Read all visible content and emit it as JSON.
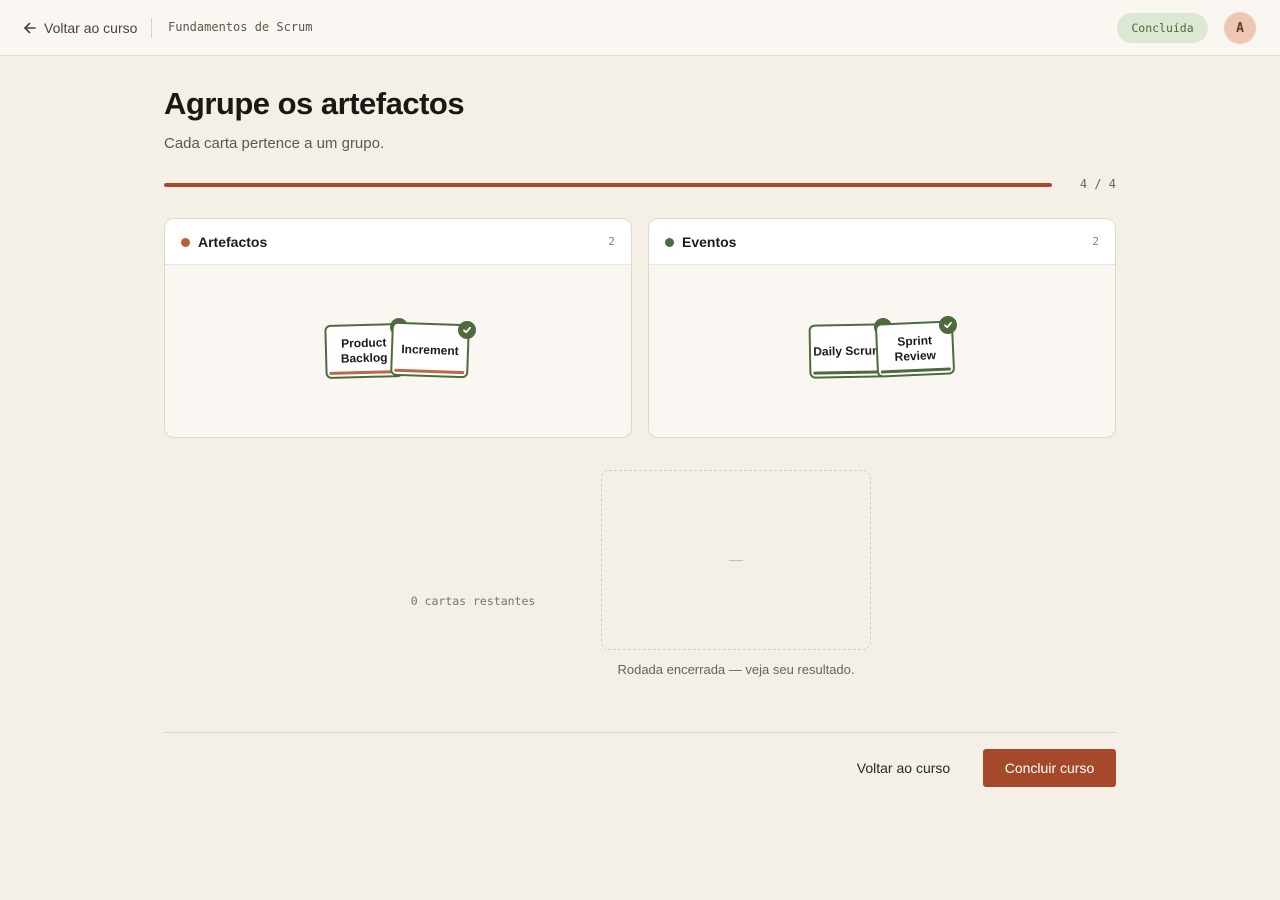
{
  "header": {
    "back_label": "Voltar ao curso",
    "course_name": "Fundamentos de Scrum",
    "status": "Concluída",
    "avatar_initial": "A"
  },
  "activity": {
    "title": "Agrupe os artefactos",
    "subtitle": "Cada carta pertence a um grupo.",
    "progress": {
      "done": 4,
      "total": 4,
      "label": "4 / 4"
    }
  },
  "groups": [
    {
      "name": "Artefactos",
      "count": "2",
      "color": "#b5603b",
      "cards": [
        {
          "label": "Product Backlog",
          "status": "correct"
        },
        {
          "label": "Increment",
          "status": "correct"
        }
      ]
    },
    {
      "name": "Eventos",
      "count": "2",
      "color": "#4e6b3d",
      "cards": [
        {
          "label": "Daily Scrum",
          "status": "correct"
        },
        {
          "label": "Sprint Review",
          "status": "correct"
        }
      ]
    }
  ],
  "deck": {
    "remaining_label": "0 cartas restantes",
    "empty_placeholder": "—",
    "round_message": "Rodada encerrada — veja seu resultado."
  },
  "footer": {
    "back_button": "Voltar ao curso",
    "finish_button": "Concluir curso"
  },
  "colors": {
    "accent": "#a6492a",
    "success": "#4e6b3d",
    "artefact_underline": "#c0674a",
    "event_underline": "#4e6b3d"
  }
}
